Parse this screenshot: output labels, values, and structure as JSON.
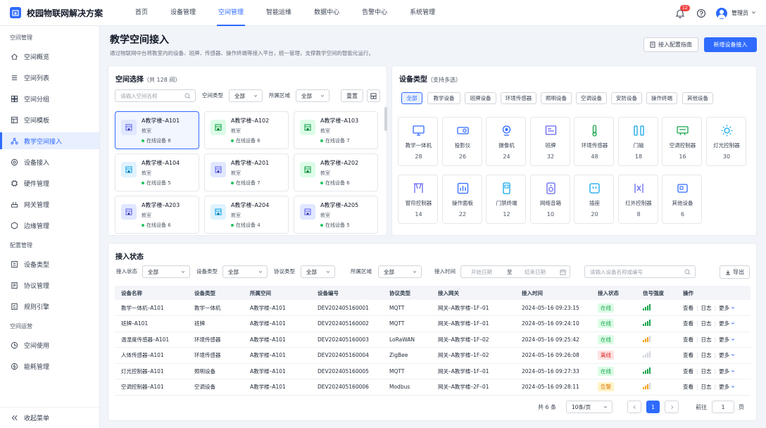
{
  "app": {
    "title": "校园物联网解决方案",
    "notif_count": "12",
    "user": "管理员"
  },
  "nav": [
    {
      "label": "首页"
    },
    {
      "label": "设备管理"
    },
    {
      "label": "空间管理"
    },
    {
      "label": "智能运维"
    },
    {
      "label": "数据中心"
    },
    {
      "label": "告警中心"
    },
    {
      "label": "系统管理"
    }
  ],
  "nav_active": 2,
  "sidebar": {
    "group1": "空间管理",
    "group2": "配置管理",
    "group3": "空间运营",
    "items": [
      {
        "label": "空间概览",
        "icon": "home-icon"
      },
      {
        "label": "空间列表",
        "icon": "list-icon"
      },
      {
        "label": "空间分组",
        "icon": "grid-icon"
      },
      {
        "label": "空间模板",
        "icon": "template-icon"
      },
      {
        "label": "教学空间接入",
        "icon": "network-icon"
      },
      {
        "label": "设备接入",
        "icon": "device-icon"
      },
      {
        "label": "硬件管理",
        "icon": "hardware-icon"
      },
      {
        "label": "网关管理",
        "icon": "gateway-icon"
      },
      {
        "label": "边缘管理",
        "icon": "edge-icon"
      },
      {
        "label": "设备类型",
        "icon": "type-icon"
      },
      {
        "label": "协议管理",
        "icon": "protocol-icon"
      },
      {
        "label": "规则引擎",
        "icon": "rule-icon"
      },
      {
        "label": "空间使用",
        "icon": "usage-icon"
      },
      {
        "label": "能耗管理",
        "icon": "energy-icon"
      }
    ],
    "collapse": "收起菜单"
  },
  "page": {
    "title": "教学空间接入",
    "desc": "通过物联网中台将教室内的设备、班牌、传感器、操作终端等接入平台，统一管理，支撑教学空间的智能化运行。",
    "guide_btn": "接入配置指南",
    "add_btn": "新增设备接入"
  },
  "space_select": {
    "title": "空间选择",
    "count": "（共 128 间）",
    "search_placeholder": "请输入空间名称",
    "type_label": "空间类型",
    "type_value": "全部",
    "area_label": "所属区域",
    "area_value": "全部",
    "reset": "重置",
    "online_prefix": "在线设备",
    "spaces": [
      {
        "name": "A教学楼–A101",
        "type": "教室",
        "online": "8"
      },
      {
        "name": "A教学楼–A102",
        "type": "教室",
        "online": "6"
      },
      {
        "name": "A教学楼–A103",
        "type": "教室",
        "online": "7"
      },
      {
        "name": "A教学楼–A104",
        "type": "教室",
        "online": "5"
      },
      {
        "name": "A教学楼–A201",
        "type": "教室",
        "online": "7"
      },
      {
        "name": "A教学楼–A202",
        "type": "教室",
        "online": "6"
      },
      {
        "name": "A教学楼–A203",
        "type": "教室",
        "online": "6"
      },
      {
        "name": "A教学楼–A204",
        "type": "教室",
        "online": "4"
      },
      {
        "name": "A教学楼–A205",
        "type": "教室",
        "online": "5"
      }
    ]
  },
  "device_types": {
    "title": "设备类型",
    "hint": "（支持多选）",
    "chips": [
      "全部",
      "教学设备",
      "班牌设备",
      "环境传感器",
      "照明设备",
      "空调设备",
      "安防设备",
      "操作终端",
      "其他设备"
    ],
    "items": [
      {
        "name": "教学一体机",
        "count": "28"
      },
      {
        "name": "投影仪",
        "count": "26"
      },
      {
        "name": "摄像机",
        "count": "24"
      },
      {
        "name": "班牌",
        "count": "32"
      },
      {
        "name": "环境传感器",
        "count": "48"
      },
      {
        "name": "门磁",
        "count": "18"
      },
      {
        "name": "空调控制器",
        "count": "16"
      },
      {
        "name": "灯光控制器",
        "count": "30"
      },
      {
        "name": "窗帘控制器",
        "count": "14"
      },
      {
        "name": "操作面板",
        "count": "22"
      },
      {
        "name": "门禁终端",
        "count": "12"
      },
      {
        "name": "网络音箱",
        "count": "10"
      },
      {
        "name": "插座",
        "count": "20"
      },
      {
        "name": "红外控制器",
        "count": "8"
      },
      {
        "name": "其他设备",
        "count": "6"
      }
    ]
  },
  "access": {
    "title": "接入状态",
    "filters": {
      "status_label": "接入状态",
      "status": "全部",
      "type_label": "设备类型",
      "type": "全部",
      "proto_label": "协议类型",
      "proto": "全部",
      "area_label": "所属区域",
      "area": "全部",
      "time_label": "接入时间",
      "start": "开始日期",
      "to": "至",
      "end": "结束日期",
      "search_placeholder": "请输入设备名称或编号",
      "export": "导出"
    },
    "columns": [
      "设备名称",
      "设备类型",
      "所属空间",
      "设备编号",
      "协议类型",
      "接入网关",
      "接入时间",
      "接入状态",
      "信号强度",
      "操作"
    ],
    "rows": [
      {
        "name": "教学一体机–A101",
        "type": "教学一体机",
        "space": "A教学楼–A101",
        "id": "DEV202405160001",
        "proto": "MQTT",
        "gw": "网关–A教学楼–1F–01",
        "time": "2024–05–16 09:23:15",
        "status": "在线",
        "signal": 4
      },
      {
        "name": "班牌–A101",
        "type": "班牌",
        "space": "A教学楼–A101",
        "id": "DEV202405160002",
        "proto": "MQTT",
        "gw": "网关–A教学楼–1F–01",
        "time": "2024–05–16 09:24:10",
        "status": "在线",
        "signal": 4
      },
      {
        "name": "温湿度传感器–A101",
        "type": "环境传感器",
        "space": "A教学楼–A101",
        "id": "DEV202405160003",
        "proto": "LoRaWAN",
        "gw": "网关–A教学楼–1F–02",
        "time": "2024–05–16 09:25:42",
        "status": "在线",
        "signal": 3
      },
      {
        "name": "人体传感器–A101",
        "type": "环境传感器",
        "space": "A教学楼–A101",
        "id": "DEV202405160004",
        "proto": "ZigBee",
        "gw": "网关–A教学楼–1F–02",
        "time": "2024–05–16 09:26:08",
        "status": "离线",
        "signal": 1
      },
      {
        "name": "灯光控制器–A101",
        "type": "照明设备",
        "space": "A教学楼–A101",
        "id": "DEV202405160005",
        "proto": "MQTT",
        "gw": "网关–A教学楼–1F–01",
        "time": "2024–05–16 09:27:33",
        "status": "在线",
        "signal": 4
      },
      {
        "name": "空调控制器–A101",
        "type": "空调设备",
        "space": "A教学楼–A101",
        "id": "DEV202405160006",
        "proto": "Modbus",
        "gw": "网关–A教学楼–2F–01",
        "time": "2024–05–16 09:28:11",
        "status": "告警",
        "signal": 3
      }
    ],
    "ops": {
      "view": "查看",
      "log": "日志",
      "more": "更多"
    },
    "pager": {
      "total": "共 6 条",
      "size": "10条/页",
      "page": "1",
      "goto": "前往",
      "goto_value": "1",
      "unit": "页"
    }
  },
  "colors": {
    "primary": "#2f6bff",
    "online": "#16a34a",
    "offline": "#dc2626",
    "warn": "#d97706"
  }
}
